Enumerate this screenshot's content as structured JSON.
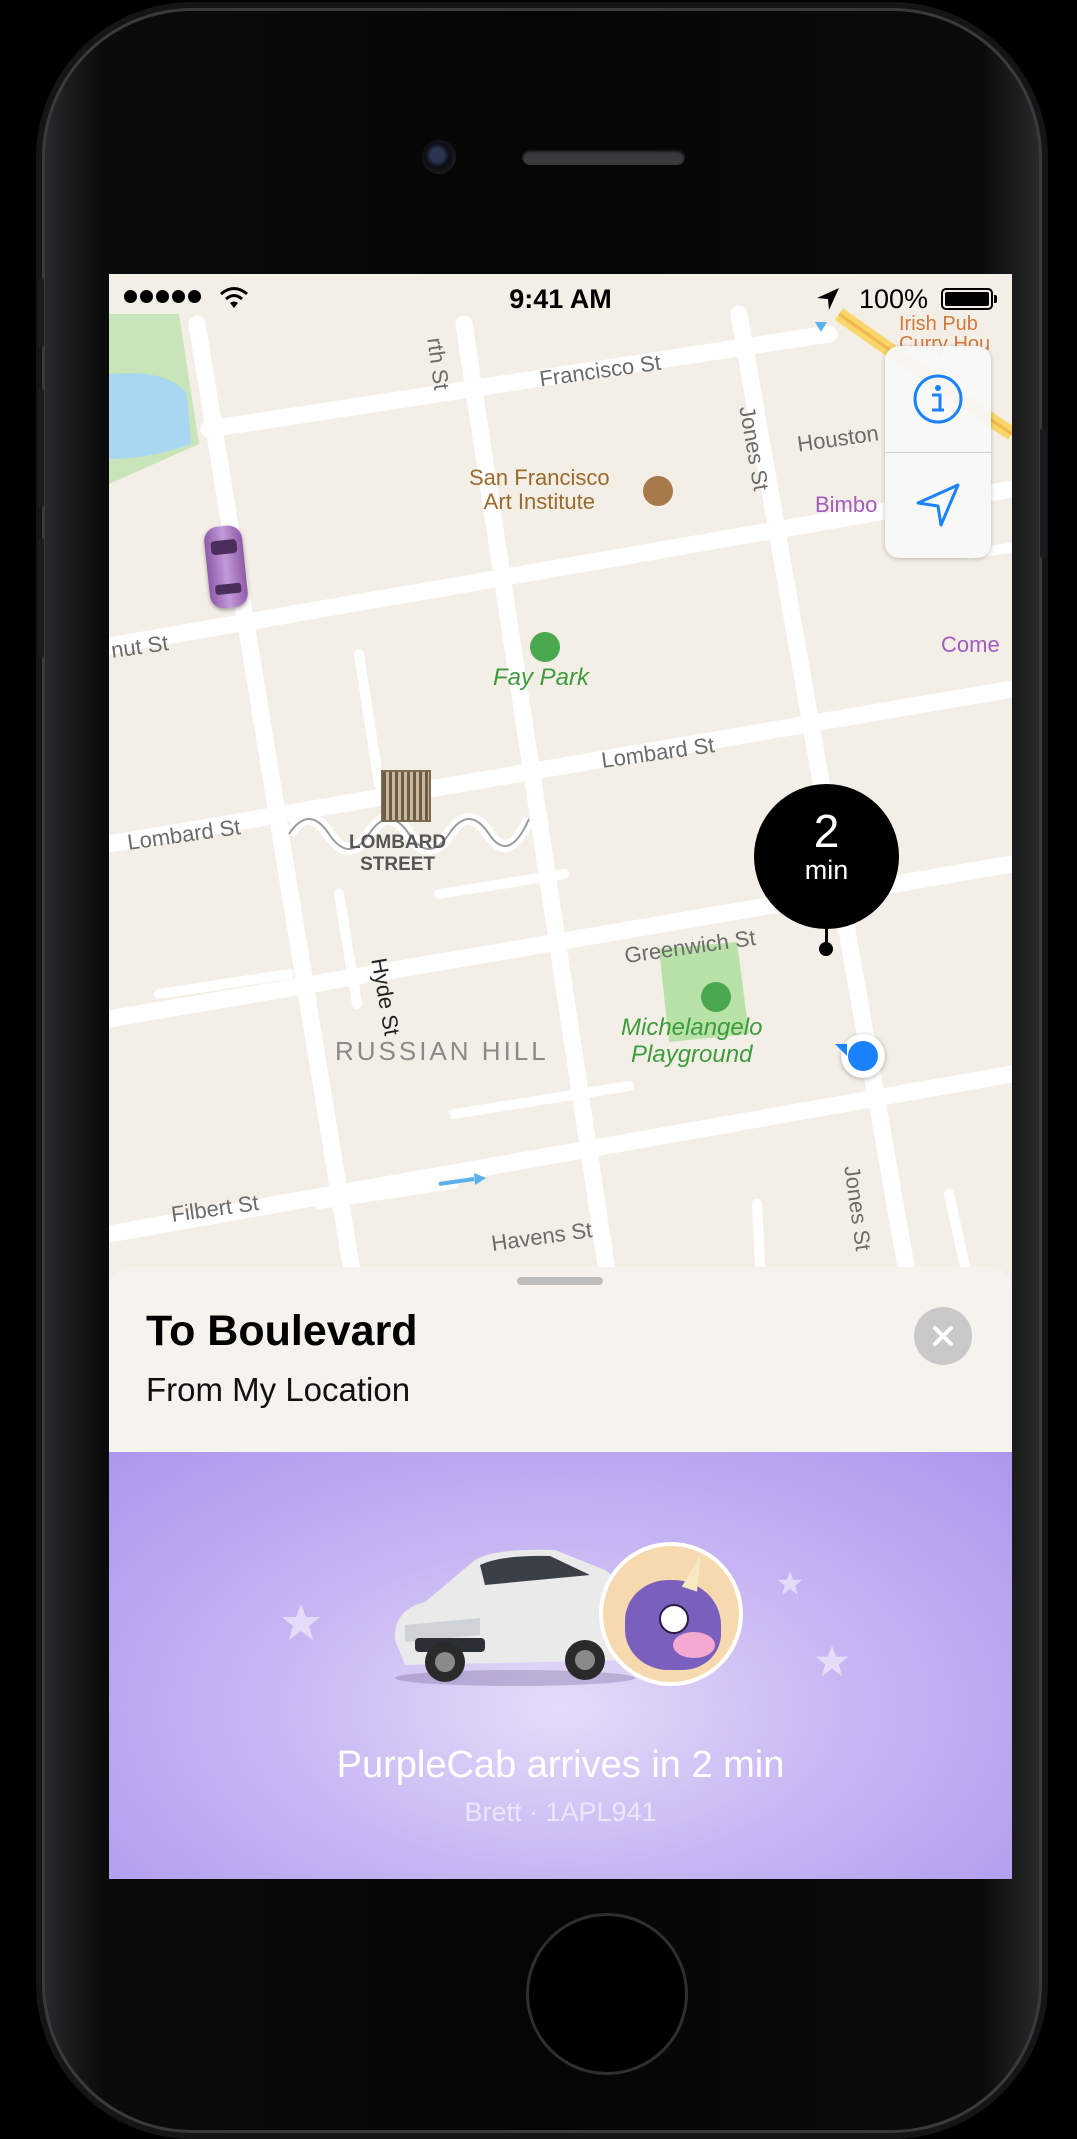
{
  "status_bar": {
    "time": "9:41 AM",
    "battery": "100%"
  },
  "map": {
    "streets": {
      "francisco": "Francisco St",
      "leavenworth": "rth St",
      "jones_top": "Jones St",
      "houston": "Houston",
      "chestnut": "nut St",
      "lombard_left": "Lombard St",
      "lombard_right": "Lombard St",
      "hyde": "Hyde St",
      "greenwich": "Greenwich St",
      "filbert": "Filbert St",
      "havens": "Havens St",
      "jones_bottom": "Jones St"
    },
    "poi": {
      "sfai_line1": "San Francisco",
      "sfai_line2": "Art Institute",
      "fay_park": "Fay Park",
      "lombard_street_1": "LOMBARD",
      "lombard_street_2": "STREET",
      "russian_hill": "RUSSIAN HILL",
      "michelangelo_1": "Michelangelo",
      "michelangelo_2": "Playground",
      "bimbo": "Bimbo",
      "comedy": "Come",
      "curry_1": "Irish Pub",
      "curry_2": "Curry Hou"
    },
    "eta_bubble": {
      "value": "2",
      "unit": "min"
    }
  },
  "sheet": {
    "title": "To Boulevard",
    "subtitle": "From My Location",
    "promo_main": "PurpleCab arrives in 2 min",
    "promo_detail": "Brett · 1APL941"
  },
  "colors": {
    "accent_blue": "#1a82fb",
    "purple_promo": "#b8a3f1",
    "park_green": "#35a33f"
  },
  "icons": [
    "info-icon",
    "locate-arrow-icon",
    "close-icon",
    "wifi-icon",
    "location-arrow-icon",
    "star-icon",
    "unicorn-avatar-icon",
    "car-icon"
  ]
}
